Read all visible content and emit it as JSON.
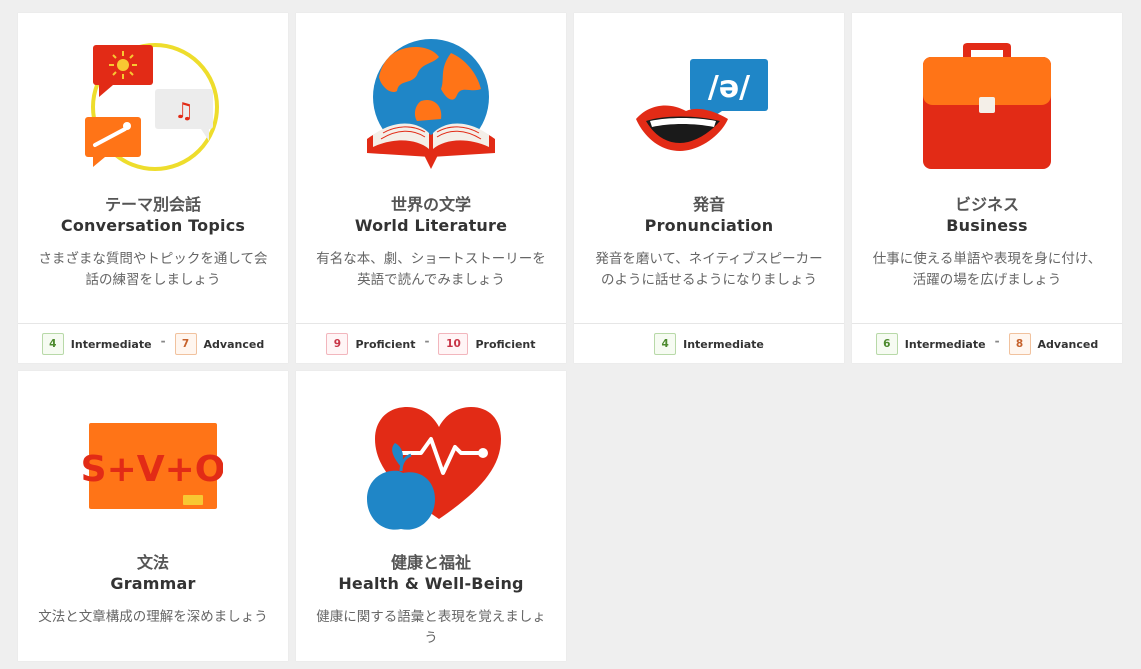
{
  "cards": [
    {
      "jp": "テーマ別会話",
      "en": "Conversation Topics",
      "desc": "さまざまな質問やトピックを通して会話の練習をしましょう",
      "levels": [
        {
          "num": "4",
          "label": "Intermediate",
          "color": "green"
        },
        {
          "num": "7",
          "label": "Advanced",
          "color": "orange"
        }
      ],
      "separator": "-"
    },
    {
      "jp": "世界の文学",
      "en": "World Literature",
      "desc": "有名な本、劇、ショートストーリーを英語で読んでみましょう",
      "levels": [
        {
          "num": "9",
          "label": "Proficient",
          "color": "pink"
        },
        {
          "num": "10",
          "label": "Proficient",
          "color": "pink"
        }
      ],
      "separator": "-"
    },
    {
      "jp": "発音",
      "en": "Pronunciation",
      "desc": "発音を磨いて、ネイティブスピーカーのように話せるようになりましょう",
      "levels": [
        {
          "num": "4",
          "label": "Intermediate",
          "color": "green"
        }
      ],
      "ipa": "/ə/"
    },
    {
      "jp": "ビジネス",
      "en": "Business",
      "desc": "仕事に使える単語や表現を身に付け、活躍の場を広げましょう",
      "levels": [
        {
          "num": "6",
          "label": "Intermediate",
          "color": "green"
        },
        {
          "num": "8",
          "label": "Advanced",
          "color": "orange"
        }
      ],
      "separator": "-"
    },
    {
      "jp": "文法",
      "en": "Grammar",
      "desc": "文法と文章構成の理解を深めましょう",
      "svo": "S+V+O"
    },
    {
      "jp": "健康と福祉",
      "en": "Health & Well-Being",
      "desc": "健康に関する語彙と表現を覚えましょう"
    }
  ],
  "colors": {
    "orange": "#ff7417",
    "red": "#e22b16",
    "blue": "#1f86c7",
    "yellow": "#eedd2c"
  }
}
